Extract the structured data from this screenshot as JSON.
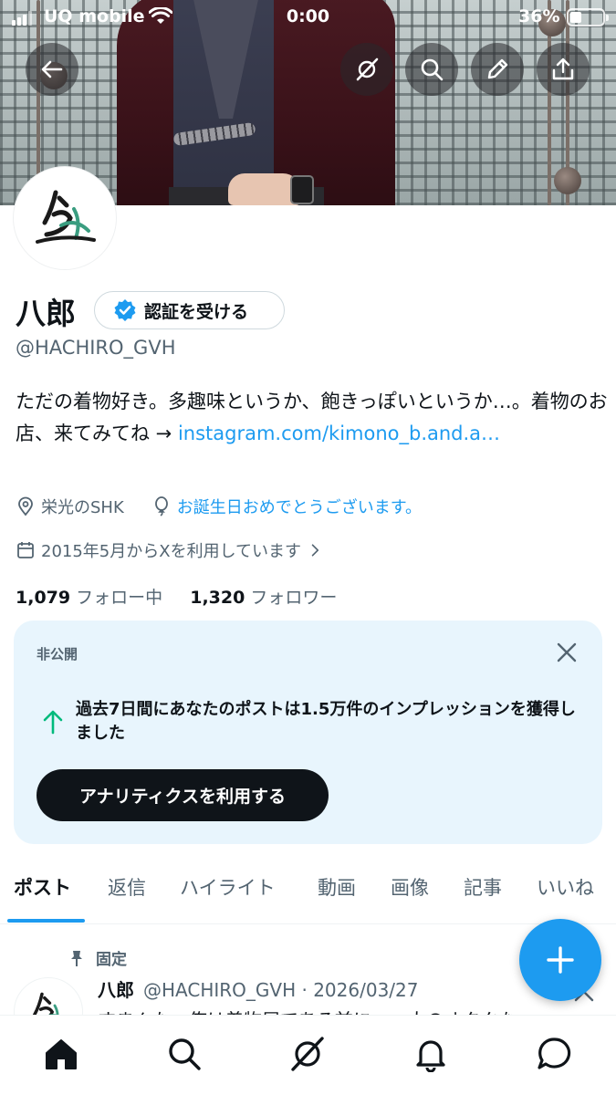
{
  "status_bar": {
    "carrier": "UQ mobile",
    "time": "0:00",
    "battery_percent": "36%",
    "battery_level": 0.36
  },
  "header_buttons": [
    {
      "icon": "back-arrow-icon"
    },
    {
      "icon": "grok-icon"
    },
    {
      "icon": "search-icon"
    },
    {
      "icon": "edit-pencil-icon"
    },
    {
      "icon": "share-icon"
    }
  ],
  "profile": {
    "name": "八郎",
    "verify_label": "認証を受ける",
    "handle": "@HACHIRO_GVH",
    "bio_text": "ただの着物好き。多趣味というか、飽きっぽいというか…。着物のお店、来てみてね → ",
    "bio_link": "instagram.com/kimono_b.and.a…",
    "location": "栄光のSHK",
    "birthday_text": "お誕生日おめでとうございます。",
    "joined": "2015年5月からXを利用しています",
    "following_count": "1,079",
    "following_label": "フォロー中",
    "followers_count": "1,320",
    "followers_label": "フォロワー"
  },
  "analytics_card": {
    "label": "非公開",
    "message": "過去7日間にあなたのポストは1.5万件のインプレッションを獲得しました",
    "button": "アナリティクスを利用する"
  },
  "tabs": [
    "ポスト",
    "返信",
    "ハイライト",
    "動画",
    "画像",
    "記事",
    "いいね"
  ],
  "active_tab": "ポスト",
  "pinned_post": {
    "pinned_label": "固定",
    "author_name": "八郎",
    "meta": "@HACHIRO_GVH · 2026/03/27",
    "text": "すまんな、俺は着物屋である前に……人のオタクな"
  },
  "bottom_nav": [
    "home-icon",
    "search-icon",
    "grok-icon",
    "notifications-icon",
    "messages-icon"
  ],
  "colors": {
    "accent": "#1d9bf0",
    "text_primary": "#0f1419",
    "text_secondary": "#536471",
    "card_bg": "#e8f5fd",
    "fab": "#1d9bf0",
    "up_arrow": "#00ba7c"
  }
}
